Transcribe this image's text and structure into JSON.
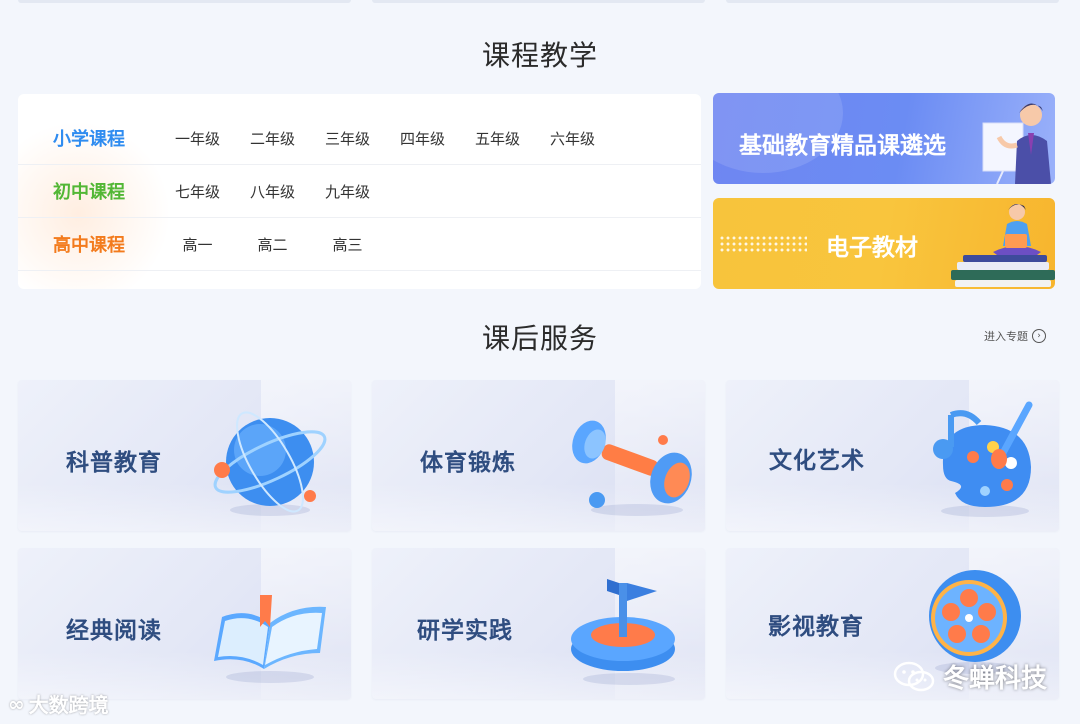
{
  "curriculum": {
    "title": "课程教学",
    "rows": [
      {
        "label": "小学课程",
        "color": "#2f8cf0",
        "grades": [
          "一年级",
          "二年级",
          "三年级",
          "四年级",
          "五年级",
          "六年级"
        ]
      },
      {
        "label": "初中课程",
        "color": "#52b735",
        "grades": [
          "七年级",
          "八年级",
          "九年级"
        ]
      },
      {
        "label": "高中课程",
        "color": "#f37b1d",
        "grades": [
          "高一",
          "高二",
          "高三"
        ]
      }
    ]
  },
  "banners": {
    "basic_edu": "基础教育精品课遴选",
    "e_textbook": "电子教材"
  },
  "services": {
    "title": "课后服务",
    "enter_link": "进入专题",
    "cards": [
      {
        "label": "科普教育",
        "icon": "globe-icon"
      },
      {
        "label": "体育锻炼",
        "icon": "dumbbell-icon"
      },
      {
        "label": "文化艺术",
        "icon": "palette-music-icon"
      },
      {
        "label": "经典阅读",
        "icon": "book-icon"
      },
      {
        "label": "研学实践",
        "icon": "flag-platform-icon"
      },
      {
        "label": "影视教育",
        "icon": "film-reel-icon"
      }
    ]
  },
  "watermarks": {
    "left": "大数跨境",
    "right": "冬蝉科技"
  }
}
